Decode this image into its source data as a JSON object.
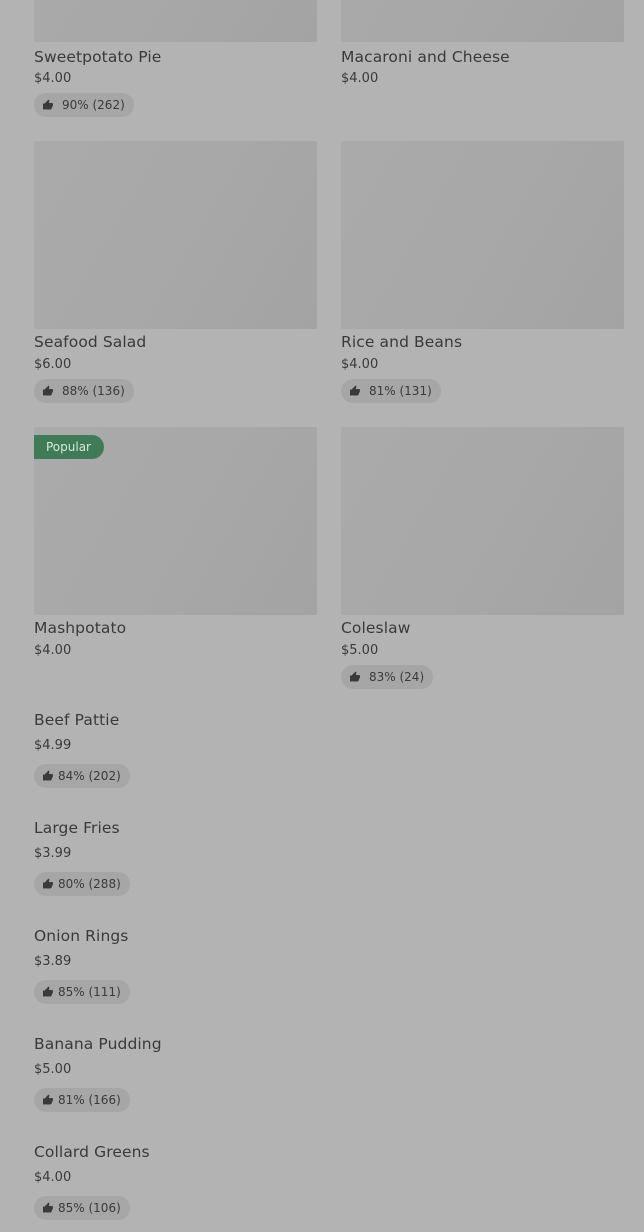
{
  "grid_items": [
    {
      "name": "Sweetpotato Pie",
      "price": "$4.00",
      "rating": "90% (262)"
    },
    {
      "name": "Macaroni and Cheese",
      "price": "$4.00",
      "rating": ""
    },
    {
      "name": "Seafood Salad",
      "price": "$6.00",
      "rating": "88% (136)"
    },
    {
      "name": "Rice and Beans",
      "price": "$4.00",
      "rating": "81% (131)"
    },
    {
      "name": "Mashpotato",
      "price": "$4.00",
      "rating": "",
      "badge": "Popular"
    },
    {
      "name": "Coleslaw",
      "price": "$5.00",
      "rating": "83% (24)"
    }
  ],
  "list_items": [
    {
      "name": "Beef Pattie",
      "price": "$4.99",
      "rating": "84% (202)"
    },
    {
      "name": "Large Fries",
      "price": "$3.99",
      "rating": "80% (288)"
    },
    {
      "name": "Onion Rings",
      "price": "$3.89",
      "rating": "85% (111)"
    },
    {
      "name": "Banana Pudding",
      "price": "$5.00",
      "rating": "81% (166)"
    },
    {
      "name": "Collard Greens",
      "price": "$4.00",
      "rating": "85% (106)"
    }
  ],
  "icons": {
    "rating": "thumbs-up-icon"
  },
  "colors": {
    "overlay": "#b3b3b3",
    "badge": "#3f7b57"
  }
}
